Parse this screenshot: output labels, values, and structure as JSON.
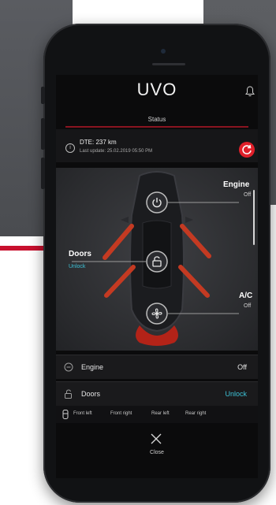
{
  "app": {
    "logo_text": "UVO",
    "header_title": "Status",
    "bell_icon": "bell-icon",
    "accent_color": "#e0202a",
    "highlight_color": "#3ec3d8"
  },
  "info": {
    "dte": "DTE: 237 km",
    "last_update": "Last update: 25.02.2019 05:50 PM",
    "info_icon": "info-icon",
    "refresh_icon": "refresh-icon"
  },
  "car": {
    "engine": {
      "label": "Engine",
      "value": "Off",
      "icon": "power-icon"
    },
    "doors": {
      "label": "Doors",
      "value": "Unlock",
      "icon": "unlock-icon"
    },
    "ac": {
      "label": "A/C",
      "value": "Off",
      "icon": "fan-icon"
    }
  },
  "rows": [
    {
      "name": "Engine",
      "value": "Off",
      "icon": "power-icon"
    },
    {
      "name": "Doors",
      "value": "Unlock",
      "icon": "unlock-icon"
    }
  ],
  "doors_detail": [
    "Front left",
    "Front right",
    "Rear left",
    "Rear right"
  ],
  "close": {
    "label": "Close",
    "icon": "close-icon"
  }
}
